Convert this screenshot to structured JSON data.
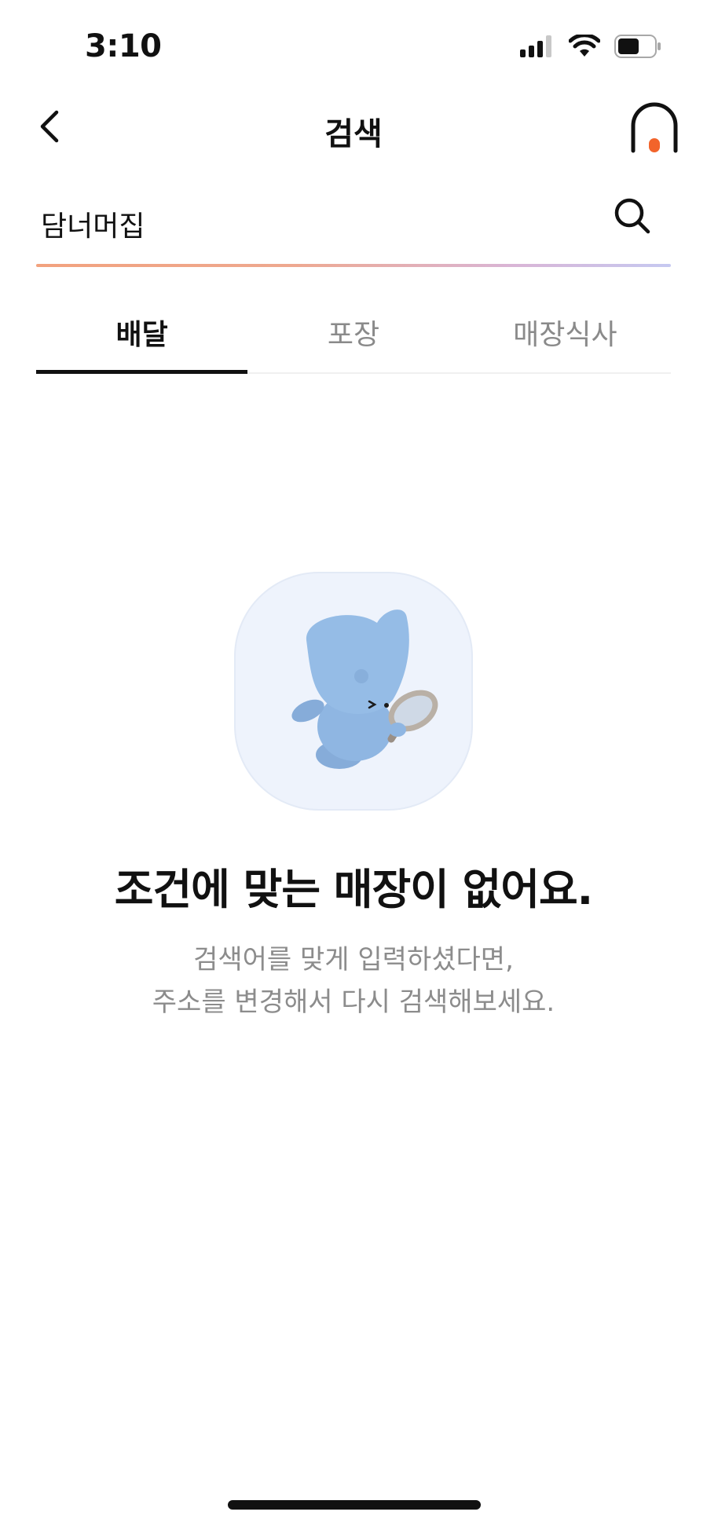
{
  "status_bar": {
    "time": "3:10",
    "icons": [
      "signal-icon",
      "wifi-icon",
      "battery-icon"
    ]
  },
  "header": {
    "title": "검색",
    "back_icon": "chevron-left-icon",
    "home_icon": "home-icon"
  },
  "search": {
    "value": "담너머집",
    "icon": "search-icon"
  },
  "tabs": [
    {
      "label": "배달",
      "active": true
    },
    {
      "label": "포장",
      "active": false
    },
    {
      "label": "매장식사",
      "active": false
    }
  ],
  "empty_state": {
    "illustration": "mascot-with-magnifier-illustration",
    "title": "조건에 맞는 매장이 없어요.",
    "line1": "검색어를 맞게 입력하셨다면,",
    "line2": "주소를 변경해서 다시 검색해보세요."
  },
  "colors": {
    "accent": "#f2642b",
    "tab_active": "#111111",
    "tab_inactive": "#8a8a8a",
    "illustration_bg": "#eef3fc",
    "mascot": "#8fb6e2"
  }
}
